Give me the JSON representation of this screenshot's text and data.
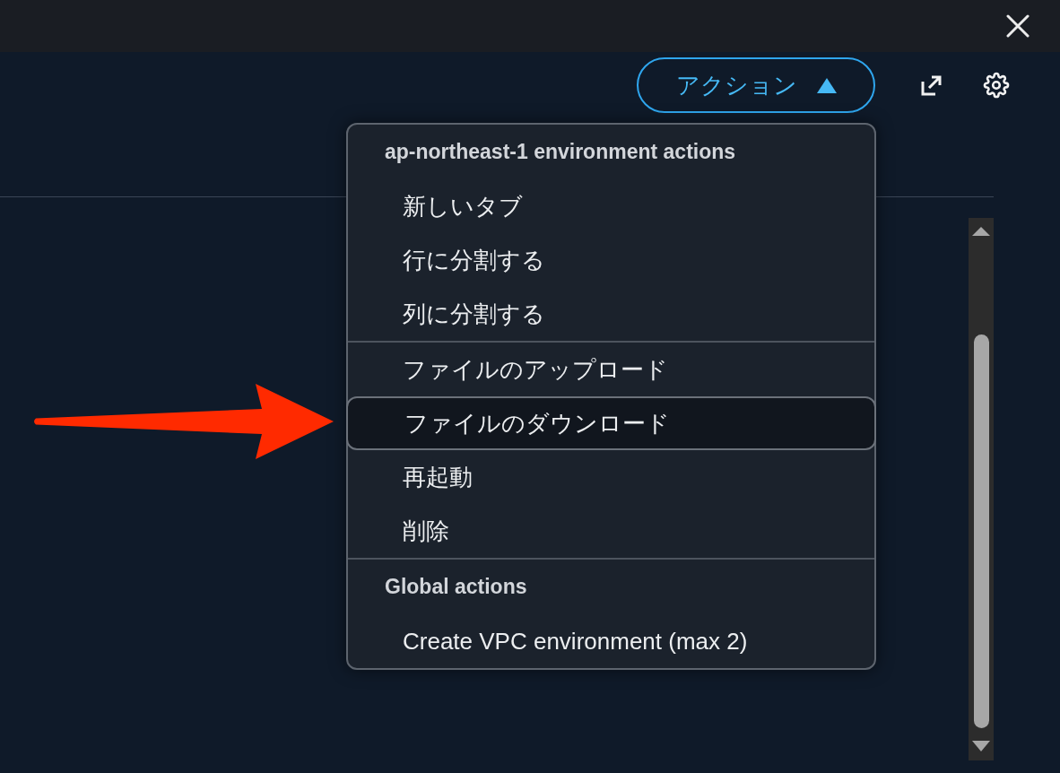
{
  "toolbar": {
    "actions_button": {
      "label": "アクション",
      "expanded": true
    }
  },
  "actions_menu": {
    "groups": [
      {
        "title": "ap-northeast-1 environment actions",
        "sections": [
          {
            "items": [
              {
                "label": "新しいタブ",
                "highlighted": false
              },
              {
                "label": "行に分割する",
                "highlighted": false
              },
              {
                "label": "列に分割する",
                "highlighted": false
              }
            ]
          },
          {
            "items": [
              {
                "label": "ファイルのアップロード",
                "highlighted": false
              },
              {
                "label": "ファイルのダウンロード",
                "highlighted": true
              },
              {
                "label": "再起動",
                "highlighted": false
              },
              {
                "label": "削除",
                "highlighted": false
              }
            ]
          }
        ]
      },
      {
        "title": "Global actions",
        "sections": [
          {
            "items": [
              {
                "label": "Create VPC environment (max 2)",
                "highlighted": false
              }
            ]
          }
        ]
      }
    ]
  }
}
